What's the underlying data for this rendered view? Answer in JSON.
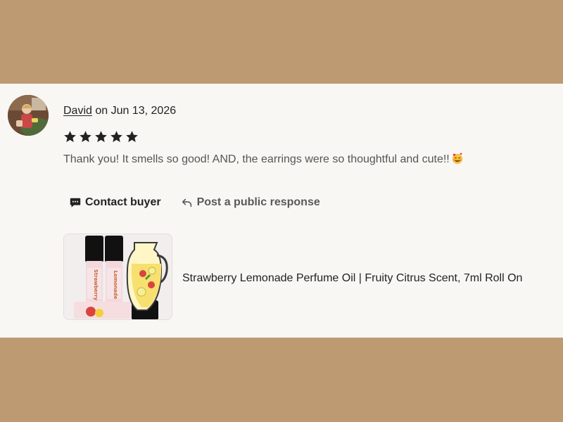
{
  "review": {
    "reviewer_name": "David",
    "date_text": "on Jun 13, 2026",
    "rating": 5,
    "rating_max": 5,
    "text": "Thank you! It smells so good! AND, the earrings were so thoughtful and cute!!",
    "emoji": "smiling-face-with-hearts-icon"
  },
  "actions": {
    "contact_label": "Contact buyer",
    "respond_label": "Post a public response"
  },
  "product": {
    "title": "Strawberry Lemonade Perfume Oil | Fruity Citrus Scent, 7ml Roll On",
    "image_label": "Strawberry Lemonade"
  },
  "colors": {
    "background": "#BE9A72",
    "card": "#F8F7F4",
    "star": "#222222",
    "text_primary": "#222222",
    "text_secondary": "#555555"
  }
}
